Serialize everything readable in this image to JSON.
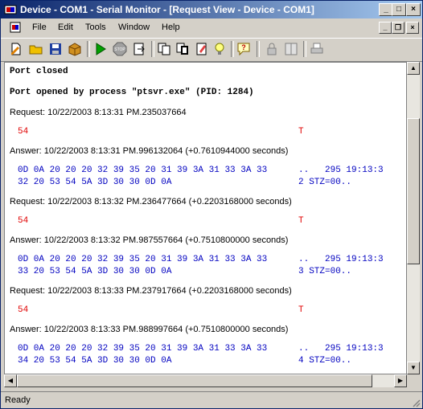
{
  "window": {
    "title": "Device - COM1 - Serial Monitor - [Request View - Device - COM1]"
  },
  "menu": [
    "File",
    "Edit",
    "Tools",
    "Window",
    "Help"
  ],
  "toolbar": {
    "icons": [
      "new-document-icon",
      "open-folder-icon",
      "save-icon",
      "package-icon",
      "play-icon",
      "stop-icon",
      "export-icon",
      "copy-icon",
      "paste-icon",
      "clear-icon",
      "filter-icon",
      "help-icon",
      "lock-icon",
      "split-icon",
      "print-icon"
    ]
  },
  "log": {
    "port_closed": "Port closed",
    "port_opened": "Port opened by process \"ptsvr.exe\" (PID: 1284)",
    "entries": [
      {
        "request_label": "Request: 10/22/2003 8:13:31 PM.235037664",
        "request_hex": "54",
        "request_ascii": "T",
        "answer_label": "Answer: 10/22/2003 8:13:31 PM.996132064 (+0.7610944000 seconds)",
        "hex1": "0D 0A 20 20 20 32 39 35 20 31 39 3A 31 33 3A 33",
        "ascii1": "..   295 19:13:3",
        "hex2": "32 20 53 54 5A 3D 30 30 0D 0A",
        "ascii2": "2 STZ=00.."
      },
      {
        "request_label": "Request: 10/22/2003 8:13:32 PM.236477664 (+0.2203168000 seconds)",
        "request_hex": "54",
        "request_ascii": "T",
        "answer_label": "Answer: 10/22/2003 8:13:32 PM.987557664 (+0.7510800000 seconds)",
        "hex1": "0D 0A 20 20 20 32 39 35 20 31 39 3A 31 33 3A 33",
        "ascii1": "..   295 19:13:3",
        "hex2": "33 20 53 54 5A 3D 30 30 0D 0A",
        "ascii2": "3 STZ=00.."
      },
      {
        "request_label": "Request: 10/22/2003 8:13:33 PM.237917664 (+0.2203168000 seconds)",
        "request_hex": "54",
        "request_ascii": "T",
        "answer_label": "Answer: 10/22/2003 8:13:33 PM.988997664 (+0.7510800000 seconds)",
        "hex1": "0D 0A 20 20 20 32 39 35 20 31 39 3A 31 33 3A 33",
        "ascii1": "..   295 19:13:3",
        "hex2": "34 20 53 54 5A 3D 30 30 0D 0A",
        "ascii2": "4 STZ=00.."
      }
    ]
  },
  "status": {
    "text": "Ready"
  },
  "colors": {
    "title_start": "#0a246a",
    "title_end": "#a6caf0",
    "request_data": "#e00000",
    "answer_data": "#0000c0"
  }
}
